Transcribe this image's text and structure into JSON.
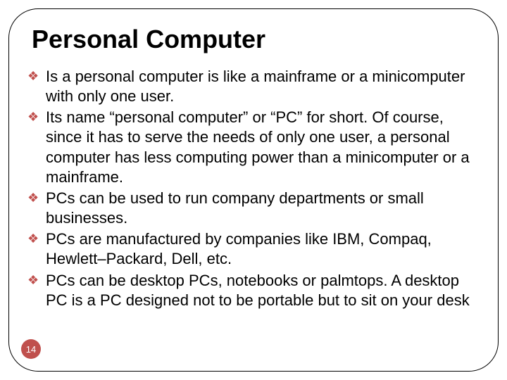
{
  "title": "Personal Computer",
  "page_number": "14",
  "bullets": [
    "Is a personal computer is like a mainframe or a minicomputer with only one user.",
    "Its name “personal computer” or “PC” for short. Of course, since it has to serve the needs of only one user, a personal computer has less computing power than a minicomputer or a mainframe.",
    "PCs can be used to run company departments or small businesses.",
    "PCs are manufactured by companies like IBM, Compaq, Hewlett–Packard, Dell, etc.",
    "PCs can be desktop PCs, notebooks or palmtops. A desktop PC is a PC designed not to be portable but to sit on your desk"
  ]
}
